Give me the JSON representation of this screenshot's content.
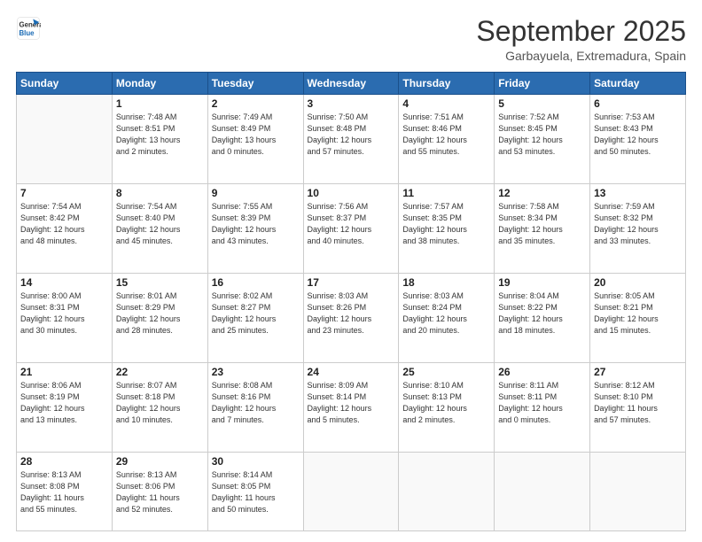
{
  "logo": {
    "line1": "General",
    "line2": "Blue"
  },
  "header": {
    "month": "September 2025",
    "location": "Garbayuela, Extremadura, Spain"
  },
  "weekdays": [
    "Sunday",
    "Monday",
    "Tuesday",
    "Wednesday",
    "Thursday",
    "Friday",
    "Saturday"
  ],
  "weeks": [
    [
      {
        "day": "",
        "info": ""
      },
      {
        "day": "1",
        "info": "Sunrise: 7:48 AM\nSunset: 8:51 PM\nDaylight: 13 hours\nand 2 minutes."
      },
      {
        "day": "2",
        "info": "Sunrise: 7:49 AM\nSunset: 8:49 PM\nDaylight: 13 hours\nand 0 minutes."
      },
      {
        "day": "3",
        "info": "Sunrise: 7:50 AM\nSunset: 8:48 PM\nDaylight: 12 hours\nand 57 minutes."
      },
      {
        "day": "4",
        "info": "Sunrise: 7:51 AM\nSunset: 8:46 PM\nDaylight: 12 hours\nand 55 minutes."
      },
      {
        "day": "5",
        "info": "Sunrise: 7:52 AM\nSunset: 8:45 PM\nDaylight: 12 hours\nand 53 minutes."
      },
      {
        "day": "6",
        "info": "Sunrise: 7:53 AM\nSunset: 8:43 PM\nDaylight: 12 hours\nand 50 minutes."
      }
    ],
    [
      {
        "day": "7",
        "info": "Sunrise: 7:54 AM\nSunset: 8:42 PM\nDaylight: 12 hours\nand 48 minutes."
      },
      {
        "day": "8",
        "info": "Sunrise: 7:54 AM\nSunset: 8:40 PM\nDaylight: 12 hours\nand 45 minutes."
      },
      {
        "day": "9",
        "info": "Sunrise: 7:55 AM\nSunset: 8:39 PM\nDaylight: 12 hours\nand 43 minutes."
      },
      {
        "day": "10",
        "info": "Sunrise: 7:56 AM\nSunset: 8:37 PM\nDaylight: 12 hours\nand 40 minutes."
      },
      {
        "day": "11",
        "info": "Sunrise: 7:57 AM\nSunset: 8:35 PM\nDaylight: 12 hours\nand 38 minutes."
      },
      {
        "day": "12",
        "info": "Sunrise: 7:58 AM\nSunset: 8:34 PM\nDaylight: 12 hours\nand 35 minutes."
      },
      {
        "day": "13",
        "info": "Sunrise: 7:59 AM\nSunset: 8:32 PM\nDaylight: 12 hours\nand 33 minutes."
      }
    ],
    [
      {
        "day": "14",
        "info": "Sunrise: 8:00 AM\nSunset: 8:31 PM\nDaylight: 12 hours\nand 30 minutes."
      },
      {
        "day": "15",
        "info": "Sunrise: 8:01 AM\nSunset: 8:29 PM\nDaylight: 12 hours\nand 28 minutes."
      },
      {
        "day": "16",
        "info": "Sunrise: 8:02 AM\nSunset: 8:27 PM\nDaylight: 12 hours\nand 25 minutes."
      },
      {
        "day": "17",
        "info": "Sunrise: 8:03 AM\nSunset: 8:26 PM\nDaylight: 12 hours\nand 23 minutes."
      },
      {
        "day": "18",
        "info": "Sunrise: 8:03 AM\nSunset: 8:24 PM\nDaylight: 12 hours\nand 20 minutes."
      },
      {
        "day": "19",
        "info": "Sunrise: 8:04 AM\nSunset: 8:22 PM\nDaylight: 12 hours\nand 18 minutes."
      },
      {
        "day": "20",
        "info": "Sunrise: 8:05 AM\nSunset: 8:21 PM\nDaylight: 12 hours\nand 15 minutes."
      }
    ],
    [
      {
        "day": "21",
        "info": "Sunrise: 8:06 AM\nSunset: 8:19 PM\nDaylight: 12 hours\nand 13 minutes."
      },
      {
        "day": "22",
        "info": "Sunrise: 8:07 AM\nSunset: 8:18 PM\nDaylight: 12 hours\nand 10 minutes."
      },
      {
        "day": "23",
        "info": "Sunrise: 8:08 AM\nSunset: 8:16 PM\nDaylight: 12 hours\nand 7 minutes."
      },
      {
        "day": "24",
        "info": "Sunrise: 8:09 AM\nSunset: 8:14 PM\nDaylight: 12 hours\nand 5 minutes."
      },
      {
        "day": "25",
        "info": "Sunrise: 8:10 AM\nSunset: 8:13 PM\nDaylight: 12 hours\nand 2 minutes."
      },
      {
        "day": "26",
        "info": "Sunrise: 8:11 AM\nSunset: 8:11 PM\nDaylight: 12 hours\nand 0 minutes."
      },
      {
        "day": "27",
        "info": "Sunrise: 8:12 AM\nSunset: 8:10 PM\nDaylight: 11 hours\nand 57 minutes."
      }
    ],
    [
      {
        "day": "28",
        "info": "Sunrise: 8:13 AM\nSunset: 8:08 PM\nDaylight: 11 hours\nand 55 minutes."
      },
      {
        "day": "29",
        "info": "Sunrise: 8:13 AM\nSunset: 8:06 PM\nDaylight: 11 hours\nand 52 minutes."
      },
      {
        "day": "30",
        "info": "Sunrise: 8:14 AM\nSunset: 8:05 PM\nDaylight: 11 hours\nand 50 minutes."
      },
      {
        "day": "",
        "info": ""
      },
      {
        "day": "",
        "info": ""
      },
      {
        "day": "",
        "info": ""
      },
      {
        "day": "",
        "info": ""
      }
    ]
  ]
}
